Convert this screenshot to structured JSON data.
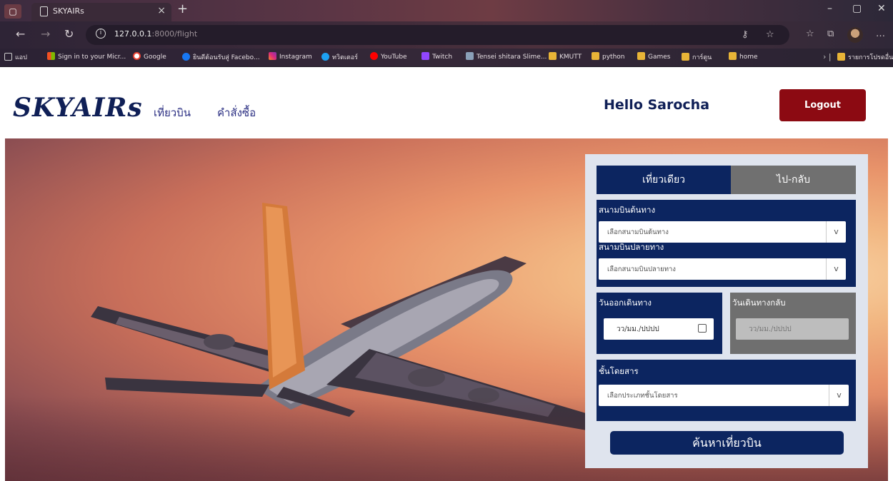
{
  "browser": {
    "tab_title": "SKYAIRs",
    "url_host": "127.0.0.1",
    "url_rest": ":8000/flight",
    "bookmarks": [
      {
        "label": "แอป"
      },
      {
        "label": "Sign in to your Micr..."
      },
      {
        "label": "Google"
      },
      {
        "label": "ยินดีต้อนรับสู่ Facebo..."
      },
      {
        "label": "Instagram"
      },
      {
        "label": "ทวิตเตอร์"
      },
      {
        "label": "YouTube"
      },
      {
        "label": "Twitch"
      },
      {
        "label": "Tensei shitara Slime..."
      },
      {
        "label": "KMUTT"
      },
      {
        "label": "python"
      },
      {
        "label": "Games"
      },
      {
        "label": "การ์ตูน"
      },
      {
        "label": "home"
      },
      {
        "label": "รายการโปรดอื่นๆ"
      }
    ]
  },
  "header": {
    "logo": "SKYAIRs",
    "nav": [
      "เที่ยวบิน",
      "คำสั่งซื้อ"
    ],
    "greeting": "Hello Sarocha",
    "logout_label": "Logout"
  },
  "search": {
    "trip_tabs": [
      "เที่ยวเดียว",
      "ไป-กลับ"
    ],
    "origin_label": "สนามบินต้นทาง",
    "origin_placeholder": "เลือกสนามบินต้นทาง",
    "destination_label": "สนามบินปลายทาง",
    "destination_placeholder": "เลือกสนามบินปลายทาง",
    "depart_label": "วันออกเดินทาง",
    "depart_value": "วว/มม./ปปปป",
    "return_label": "วันเดินทางกลับ",
    "return_value": "วว/มม./ปปปป",
    "class_label": "ชั้นโดยสาร",
    "class_placeholder": "เลือกประเภทชั้นโดยสาร",
    "chevron": "v",
    "submit_label": "ค้นหาเที่ยวบิน"
  },
  "colors": {
    "navy": "#0c2560",
    "logout": "#8c0a12",
    "gray_tab": "#707070"
  }
}
